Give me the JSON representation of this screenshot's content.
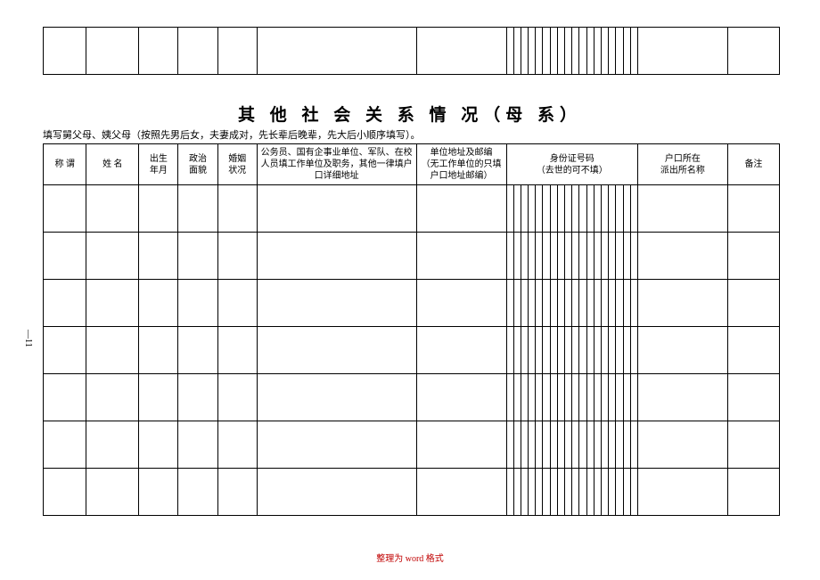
{
  "title": "其 他 社 会 关 系 情 况（母 系）",
  "instruction": "填写舅父母、姨父母（按照先男后女，夫妻成对，先长辈后晚辈，先大后小顺序填写）。",
  "headers": {
    "chengwei": "称 谓",
    "xingming": "姓 名",
    "chusheng": "出生\n年月",
    "zhengzhi": "政治\n面貌",
    "hunyin": "婚姻\n状况",
    "gongzuo": "公务员、国有企事业单位、军队、在校人员填工作单位及职务，其他一律填户口详细地址",
    "danwei": "单位地址及邮编\n（无工作单位的只填户口地址邮编）",
    "shenfen": "身份证号码\n（去世的可不填）",
    "hukou": "户口所在\n派出所名称",
    "beizhu": "备注"
  },
  "page_number": "—11",
  "footer": "整理为 word 格式",
  "rows": [
    {},
    {},
    {},
    {},
    {},
    {},
    {}
  ]
}
